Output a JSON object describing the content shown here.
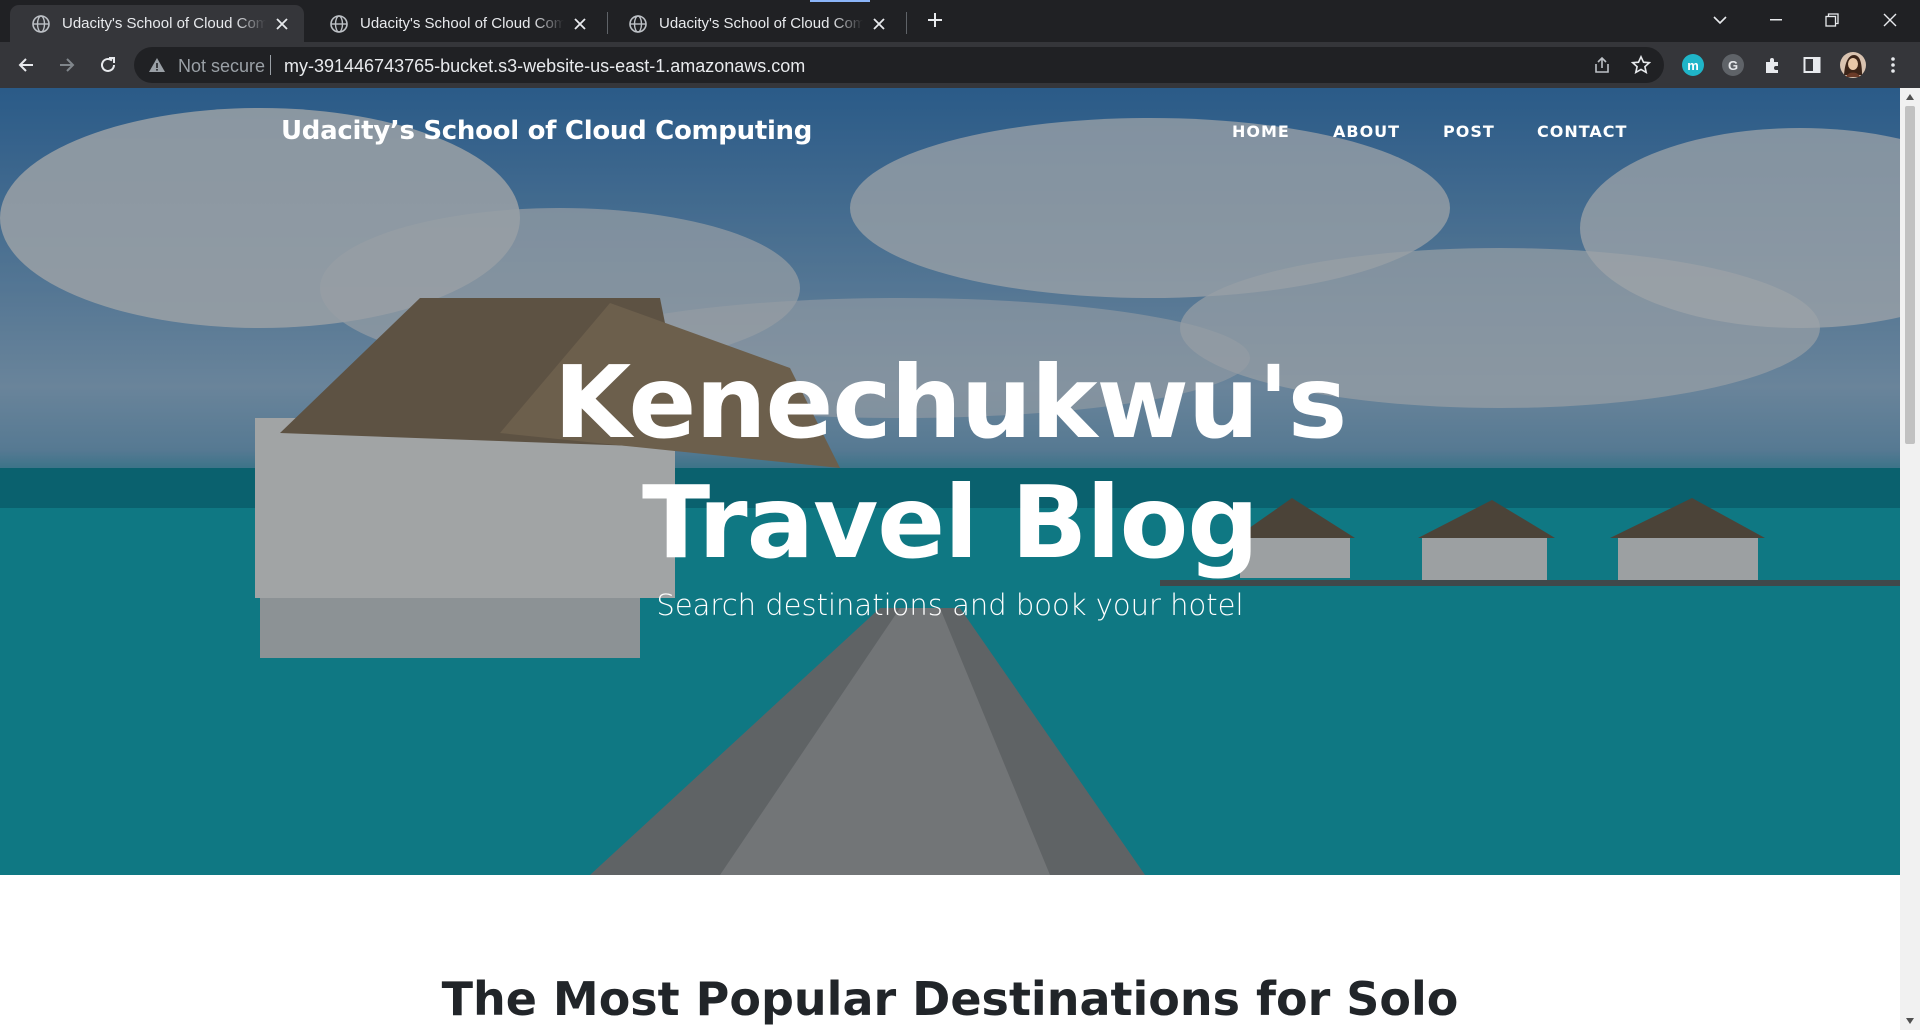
{
  "browser": {
    "tabs": [
      {
        "title": "Udacity's School of Cloud Computing"
      },
      {
        "title": "Udacity's School of Cloud Computing"
      },
      {
        "title": "Udacity's School of Cloud Computing"
      }
    ],
    "address_bar": {
      "security_label": "Not secure",
      "url": "my-391446743765-bucket.s3-website-us-east-1.amazonaws.com"
    },
    "extensions": [
      {
        "name": "m-extension-icon",
        "letter": "m",
        "color": "#1fb5c8"
      },
      {
        "name": "grammarly-extension-icon",
        "letter": "G",
        "color": "#5f6368"
      }
    ]
  },
  "site": {
    "brand": "Udacity’s School of Cloud Computing",
    "nav": [
      "HOME",
      "ABOUT",
      "POST",
      "CONTACT"
    ],
    "hero": {
      "title_line1": "Kenechukwu's",
      "title_line2": "Travel Blog",
      "subtitle": "Search destinations and book your hotel"
    },
    "section_heading": "The Most Popular Destinations for Solo"
  },
  "colors": {
    "browser_dark": "#202124",
    "toolbar": "#35363a",
    "heading_text": "#212529"
  }
}
